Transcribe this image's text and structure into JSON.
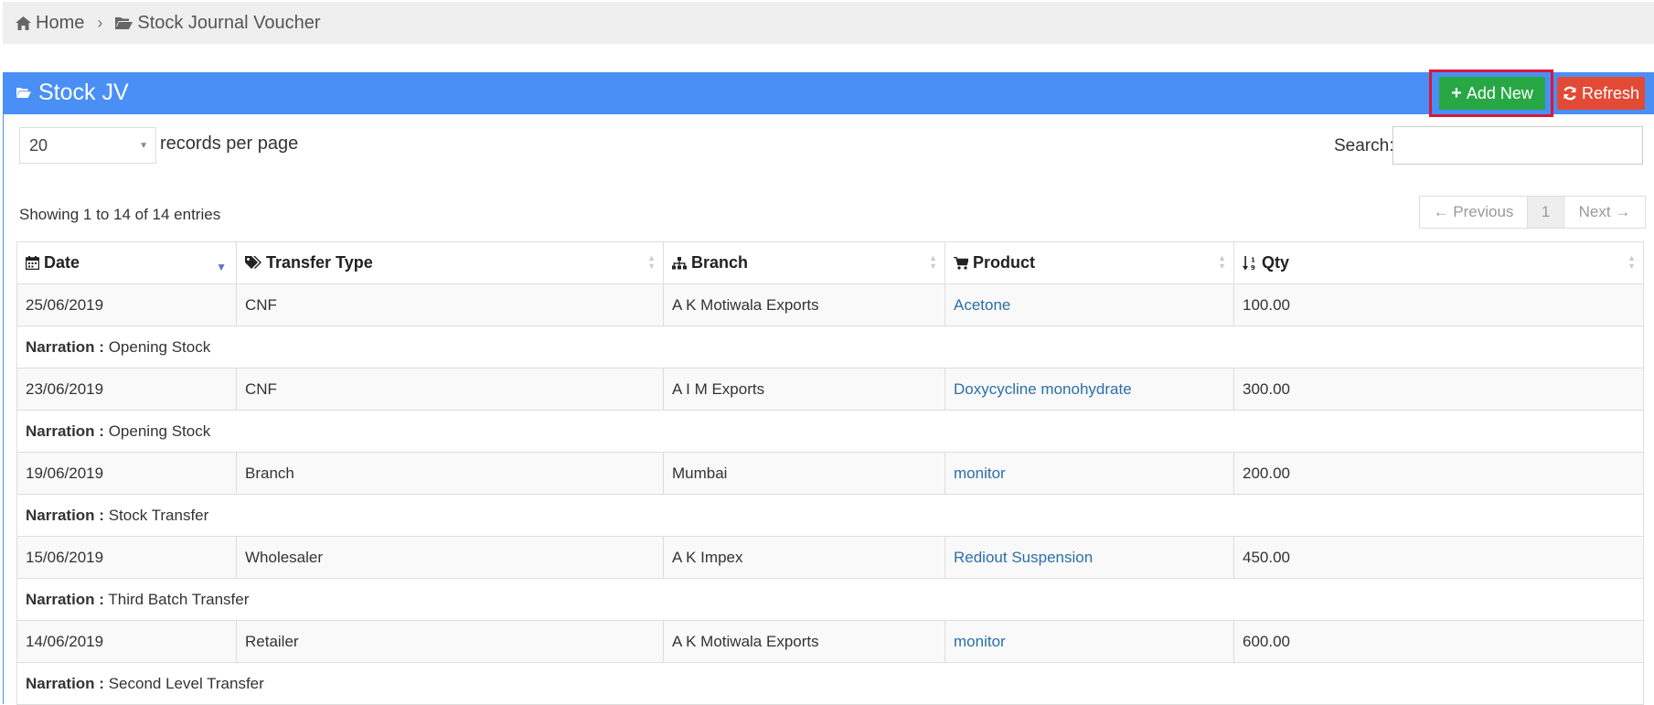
{
  "breadcrumb": {
    "home": "Home",
    "page": "Stock Journal Voucher"
  },
  "panel": {
    "title": "Stock JV",
    "add_new_label": "Add New",
    "refresh_label": "Refresh"
  },
  "controls": {
    "page_length": "20",
    "records_per_page_label": "records per page",
    "search_label": "Search:",
    "search_value": ""
  },
  "info": "Showing 1 to 14 of 14 entries",
  "pagination": {
    "previous": "← Previous",
    "current": "1",
    "next": "Next →"
  },
  "columns": [
    "Date",
    "Transfer Type",
    "Branch",
    "Product",
    "Qty"
  ],
  "narration_label": "Narration :",
  "rows": [
    {
      "date": "25/06/2019",
      "type": "CNF",
      "branch": "A K Motiwala Exports",
      "product": "Acetone",
      "qty": "100.00",
      "narration": "Opening Stock"
    },
    {
      "date": "23/06/2019",
      "type": "CNF",
      "branch": "A I M Exports",
      "product": "Doxycycline monohydrate",
      "qty": "300.00",
      "narration": "Opening Stock"
    },
    {
      "date": "19/06/2019",
      "type": "Branch",
      "branch": "Mumbai",
      "product": "monitor",
      "qty": "200.00",
      "narration": "Stock Transfer"
    },
    {
      "date": "15/06/2019",
      "type": "Wholesaler",
      "branch": "A K Impex",
      "product": "Rediout Suspension",
      "qty": "450.00",
      "narration": "Third Batch Transfer"
    },
    {
      "date": "14/06/2019",
      "type": "Retailer",
      "branch": "A K Motiwala Exports",
      "product": "monitor",
      "qty": "600.00",
      "narration": "Second Level Transfer"
    }
  ]
}
